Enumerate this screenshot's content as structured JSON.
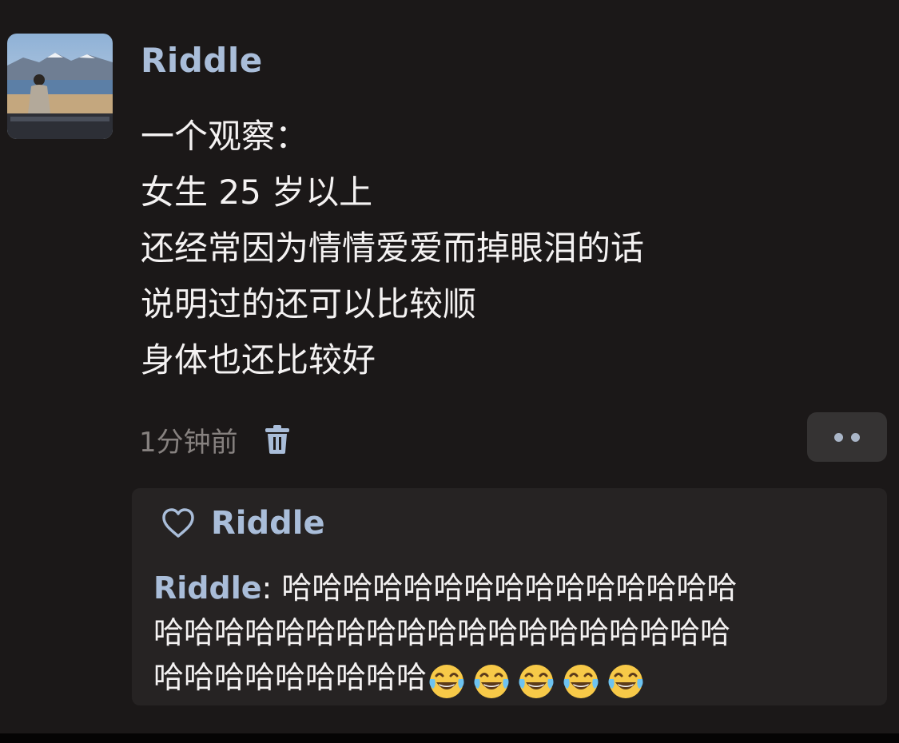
{
  "post": {
    "author": "Riddle",
    "lines": [
      "一个观察：",
      "女生 25 岁以上",
      "还经常因为情情爱爱而掉眼泪的话",
      "说明过的还可以比较顺",
      "身体也还比较好"
    ],
    "timestamp": "1分钟前"
  },
  "likes": {
    "icon": "heart-outline-icon",
    "name": "Riddle"
  },
  "comment": {
    "author": "Riddle",
    "separator": ": ",
    "line1": "哈哈哈哈哈哈哈哈哈哈哈哈哈哈哈",
    "line2": "哈哈哈哈哈哈哈哈哈哈哈哈哈哈哈哈哈哈哈",
    "line3": "哈哈哈哈哈哈哈哈哈",
    "emoji": "tears-of-joy-icon",
    "emoji_count": 5
  },
  "colors": {
    "name_accent": "#a9bdd9",
    "text_primary": "#f4f2f2",
    "text_muted": "#86817f",
    "background": "#1b1818",
    "comment_background": "#262323"
  }
}
